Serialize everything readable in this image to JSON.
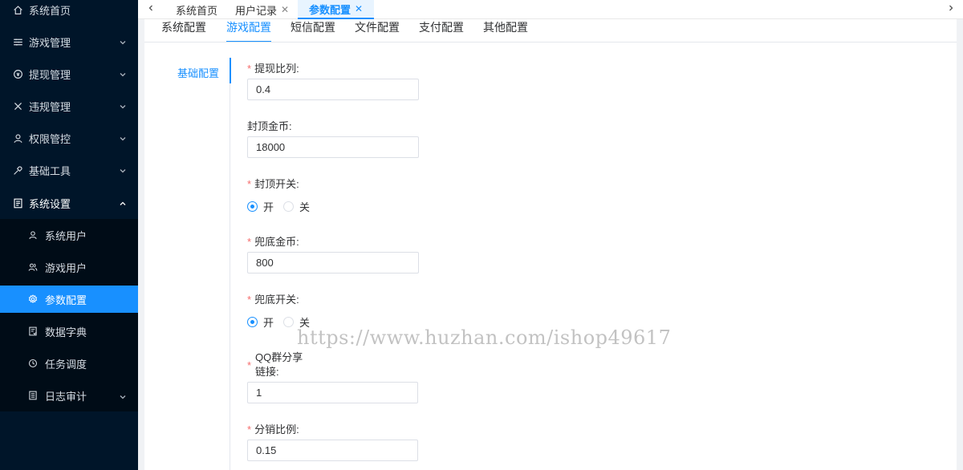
{
  "sidebar": {
    "items": [
      {
        "label": "系统首页",
        "icon": "home-icon"
      },
      {
        "label": "游戏管理",
        "icon": "list-icon"
      },
      {
        "label": "提现管理",
        "icon": "withdraw-icon"
      },
      {
        "label": "违规管理",
        "icon": "close-icon"
      },
      {
        "label": "权限管控",
        "icon": "user-icon"
      },
      {
        "label": "基础工具",
        "icon": "tool-icon"
      },
      {
        "label": "系统设置",
        "icon": "settings-icon"
      }
    ],
    "submenu": [
      {
        "label": "系统用户",
        "icon": "user-icon"
      },
      {
        "label": "游戏用户",
        "icon": "users-icon"
      },
      {
        "label": "参数配置",
        "icon": "gear-icon",
        "active": true
      },
      {
        "label": "数据字典",
        "icon": "dictionary-icon"
      },
      {
        "label": "任务调度",
        "icon": "clock-icon"
      },
      {
        "label": "日志审计",
        "icon": "log-icon"
      }
    ]
  },
  "tags": [
    {
      "label": "系统首页"
    },
    {
      "label": "用户记录"
    },
    {
      "label": "参数配置",
      "active": true
    }
  ],
  "tabs": [
    "系统配置",
    "游戏配置",
    "短信配置",
    "文件配置",
    "支付配置",
    "其他配置"
  ],
  "active_tab": "游戏配置",
  "side_tab": "基础配置",
  "form": {
    "withdraw_ratio": {
      "label": "提现比列:",
      "value": "0.4",
      "required": true
    },
    "cap_coins": {
      "label": "封顶金币:",
      "value": "18000",
      "required": false
    },
    "cap_switch": {
      "label": "封顶开关:",
      "on": "开",
      "off": "关",
      "selected": "开",
      "required": true
    },
    "floor_coins": {
      "label": "兜底金币:",
      "value": "800",
      "required": true
    },
    "floor_switch": {
      "label": "兜底开关:",
      "on": "开",
      "off": "关",
      "selected": "开",
      "required": true
    },
    "qq_share": {
      "label_line1": "QQ群分享",
      "label_line2": "链接:",
      "value": "1",
      "required": true
    },
    "dist_ratio": {
      "label": "分销比例:",
      "value": "0.15",
      "required": true
    }
  },
  "watermark": "https://www.huzhan.com/ishop49617",
  "colors": {
    "sidebar_bg": "#001529",
    "accent": "#1890ff",
    "required": "#f56c6c"
  }
}
